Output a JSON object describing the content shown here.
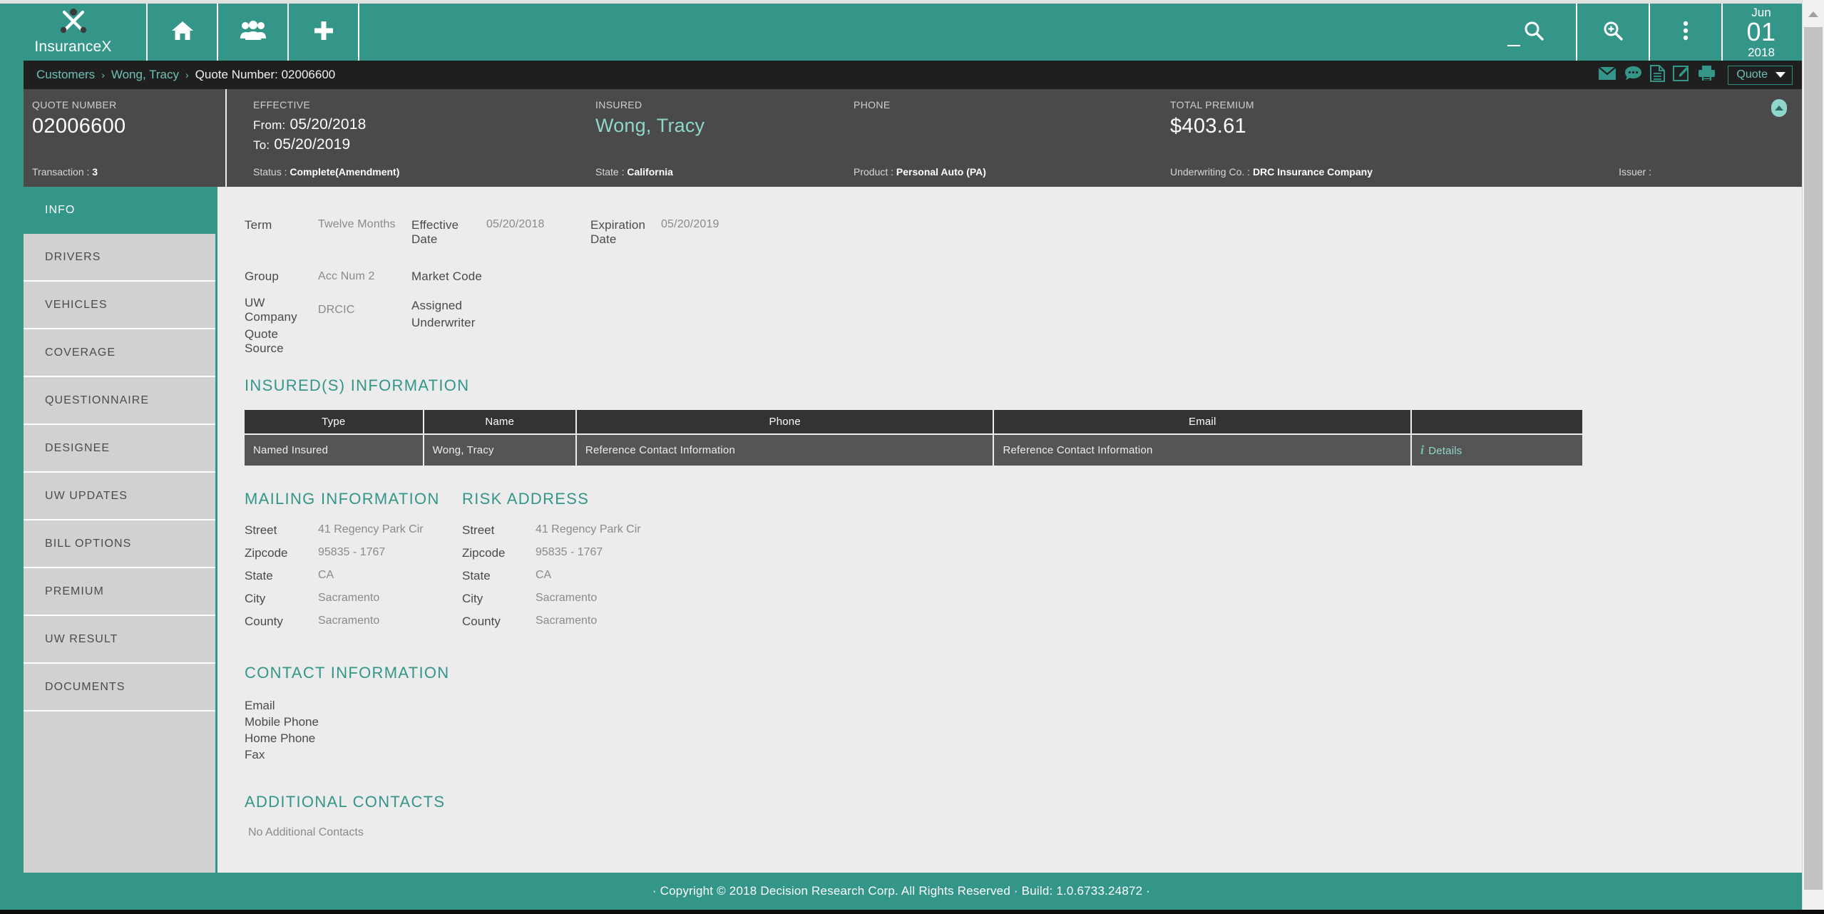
{
  "brand": {
    "name": "InsuranceX",
    "logo_icon": "crossed-pins-logo-icon"
  },
  "topnav": {
    "items": [
      {
        "name": "home",
        "icon": "home-icon"
      },
      {
        "name": "customers",
        "icon": "users-icon"
      },
      {
        "name": "add",
        "icon": "plus-icon"
      }
    ],
    "search_icon": "search-icon",
    "zoom_icon": "zoom-in-icon",
    "more_icon": "kebab-menu-icon",
    "minimize_icon": "minimize-icon",
    "date": {
      "month": "Jun",
      "day": "01",
      "year": "2018"
    }
  },
  "breadcrumb": {
    "items": [
      "Customers",
      "Wong, Tracy"
    ],
    "current": "Quote Number: 02006600",
    "separator": "›",
    "actions": [
      {
        "name": "email",
        "icon": "envelope-icon"
      },
      {
        "name": "notes",
        "icon": "comment-icon"
      },
      {
        "name": "document",
        "icon": "document-icon"
      },
      {
        "name": "edit",
        "icon": "edit-icon"
      },
      {
        "name": "print",
        "icon": "printer-icon"
      }
    ],
    "dropdown_label": "Quote"
  },
  "summary": {
    "quote": {
      "label": "QUOTE NUMBER",
      "value": "02006600",
      "foot_label": "Transaction :",
      "foot_value": "3"
    },
    "effective": {
      "label": "EFFECTIVE",
      "from_label": "From:",
      "from_value": "05/20/2018",
      "to_label": "To:",
      "to_value": "05/20/2019",
      "foot_label": "Status :",
      "foot_value": "Complete(Amendment)"
    },
    "insured": {
      "label": "INSURED",
      "value": "Wong, Tracy",
      "foot_label": "State :",
      "foot_value": "California"
    },
    "phone": {
      "label": "PHONE",
      "value": "",
      "foot_label": "Product :",
      "foot_value": "Personal Auto (PA)"
    },
    "premium": {
      "label": "TOTAL PREMIUM",
      "value": "$403.61",
      "foot_label": "Underwriting Co. :",
      "foot_value": "DRC Insurance Company",
      "issuer_label": "Issuer :"
    },
    "collapse_icon": "chevron-up-icon"
  },
  "sidebar": {
    "items": [
      {
        "label": "INFO",
        "active": true
      },
      {
        "label": "DRIVERS",
        "active": false
      },
      {
        "label": "VEHICLES",
        "active": false
      },
      {
        "label": "COVERAGE",
        "active": false
      },
      {
        "label": "QUESTIONNAIRE",
        "active": false
      },
      {
        "label": "DESIGNEE",
        "active": false
      },
      {
        "label": "UW UPDATES",
        "active": false
      },
      {
        "label": "BILL OPTIONS",
        "active": false
      },
      {
        "label": "PREMIUM",
        "active": false
      },
      {
        "label": "UW RESULT",
        "active": false
      },
      {
        "label": "DOCUMENTS",
        "active": false
      }
    ]
  },
  "main": {
    "term_row": {
      "term_label": "Term",
      "term_value": "Twelve Months",
      "effective_date_label": "Effective Date",
      "effective_date_value": "05/20/2018",
      "expiration_date_label": "Expiration Date",
      "expiration_date_value": "05/20/2019"
    },
    "lower_grid": {
      "group_label": "Group",
      "group_value": "Acc Num 2",
      "uw_company_label": "UW Company",
      "uw_company_value": "DRCIC",
      "quote_source_label": "Quote Source",
      "quote_source_value": "",
      "market_code_label": "Market Code",
      "market_code_value": "",
      "assigned_uw_label_line1": "Assigned",
      "assigned_uw_label_line2": "Underwriter",
      "assigned_uw_value": ""
    },
    "insured_section": {
      "title": "INSURED(S) INFORMATION",
      "columns": [
        "Type",
        "Name",
        "Phone",
        "Email",
        ""
      ],
      "rows": [
        {
          "type": "Named Insured",
          "name": "Wong, Tracy",
          "phone": "Reference Contact Information",
          "email": "Reference Contact Information",
          "action": "Details",
          "action_icon": "info-icon"
        }
      ]
    },
    "mailing": {
      "title": "MAILING INFORMATION",
      "fields": [
        {
          "key": "Street",
          "value": "41 Regency Park Cir"
        },
        {
          "key": "Zipcode",
          "value": "95835 - 1767"
        },
        {
          "key": "State",
          "value": "CA"
        },
        {
          "key": "City",
          "value": "Sacramento"
        },
        {
          "key": "County",
          "value": "Sacramento"
        }
      ]
    },
    "risk": {
      "title": "RISK ADDRESS",
      "fields": [
        {
          "key": "Street",
          "value": "41 Regency Park Cir"
        },
        {
          "key": "Zipcode",
          "value": "95835 - 1767"
        },
        {
          "key": "State",
          "value": "CA"
        },
        {
          "key": "City",
          "value": "Sacramento"
        },
        {
          "key": "County",
          "value": "Sacramento"
        }
      ]
    },
    "contact": {
      "title": "CONTACT INFORMATION",
      "fields": [
        "Email",
        "Mobile Phone",
        "Home Phone",
        "Fax"
      ]
    },
    "additional": {
      "title": "ADDITIONAL CONTACTS",
      "empty_text": "No Additional Contacts"
    }
  },
  "footer": {
    "text": "· Copyright © 2018 Decision Research Corp. All Rights Reserved · Build: 1.0.6733.24872 ·"
  },
  "colors": {
    "teal": "#339688",
    "teal_light": "#8fd6cb",
    "dark_bar": "#1f1f1f",
    "summary_bg": "#4a4a4a",
    "sidebar_bg": "#d1d1d1",
    "content_bg": "#ececec",
    "table_head": "#333333",
    "table_row": "#555555"
  }
}
